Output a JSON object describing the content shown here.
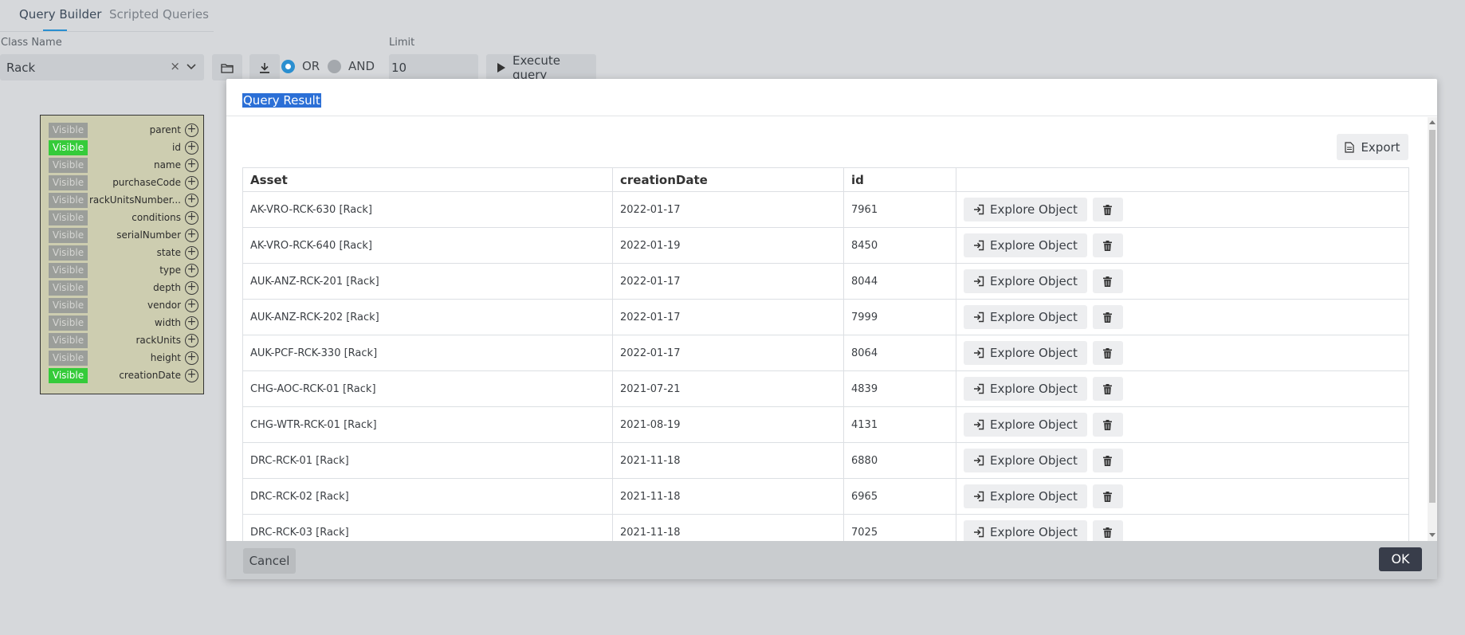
{
  "tabs": [
    {
      "label": "Query Builder",
      "active": true
    },
    {
      "label": "Scripted Queries",
      "active": false
    }
  ],
  "query_form": {
    "class_name_label": "Class Name",
    "class_name_value": "Rack",
    "clear_glyph": "×",
    "or_label": "OR",
    "and_label": "AND",
    "selected_operator": "OR",
    "limit_label": "Limit",
    "limit_value": "10",
    "execute_label": "Execute query"
  },
  "attributes": [
    {
      "visibility": "Visible",
      "name": "parent",
      "visible": false
    },
    {
      "visibility": "Visible",
      "name": "id",
      "visible": true
    },
    {
      "visibility": "Visible",
      "name": "name",
      "visible": false
    },
    {
      "visibility": "Visible",
      "name": "purchaseCode",
      "visible": false
    },
    {
      "visibility": "Visible",
      "name": "rackUnitsNumber...",
      "visible": false
    },
    {
      "visibility": "Visible",
      "name": "conditions",
      "visible": false
    },
    {
      "visibility": "Visible",
      "name": "serialNumber",
      "visible": false
    },
    {
      "visibility": "Visible",
      "name": "state",
      "visible": false
    },
    {
      "visibility": "Visible",
      "name": "type",
      "visible": false
    },
    {
      "visibility": "Visible",
      "name": "depth",
      "visible": false
    },
    {
      "visibility": "Visible",
      "name": "vendor",
      "visible": false
    },
    {
      "visibility": "Visible",
      "name": "width",
      "visible": false
    },
    {
      "visibility": "Visible",
      "name": "rackUnits",
      "visible": false
    },
    {
      "visibility": "Visible",
      "name": "height",
      "visible": false
    },
    {
      "visibility": "Visible",
      "name": "creationDate",
      "visible": true
    }
  ],
  "modal": {
    "title": "Query Result",
    "export_label": "Export",
    "columns": [
      "Asset",
      "creationDate",
      "id",
      ""
    ],
    "explore_label": "Explore Object",
    "rows": [
      {
        "asset": "AK-VRO-RCK-630 [Rack]",
        "creationDate": "2022-01-17",
        "id": "7961"
      },
      {
        "asset": "AK-VRO-RCK-640 [Rack]",
        "creationDate": "2022-01-19",
        "id": "8450"
      },
      {
        "asset": "AUK-ANZ-RCK-201 [Rack]",
        "creationDate": "2022-01-17",
        "id": "8044"
      },
      {
        "asset": "AUK-ANZ-RCK-202 [Rack]",
        "creationDate": "2022-01-17",
        "id": "7999"
      },
      {
        "asset": "AUK-PCF-RCK-330 [Rack]",
        "creationDate": "2022-01-17",
        "id": "8064"
      },
      {
        "asset": "CHG-AOC-RCK-01 [Rack]",
        "creationDate": "2021-07-21",
        "id": "4839"
      },
      {
        "asset": "CHG-WTR-RCK-01 [Rack]",
        "creationDate": "2021-08-19",
        "id": "4131"
      },
      {
        "asset": "DRC-RCK-01 [Rack]",
        "creationDate": "2021-11-18",
        "id": "6880"
      },
      {
        "asset": "DRC-RCK-02 [Rack]",
        "creationDate": "2021-11-18",
        "id": "6965"
      },
      {
        "asset": "DRC-RCK-03 [Rack]",
        "creationDate": "2021-11-18",
        "id": "7025"
      }
    ],
    "cancel_label": "Cancel",
    "ok_label": "OK"
  },
  "colors": {
    "accent": "#2b8fd0",
    "visible_on": "#35cb3a",
    "ok_button": "#383d4a"
  }
}
